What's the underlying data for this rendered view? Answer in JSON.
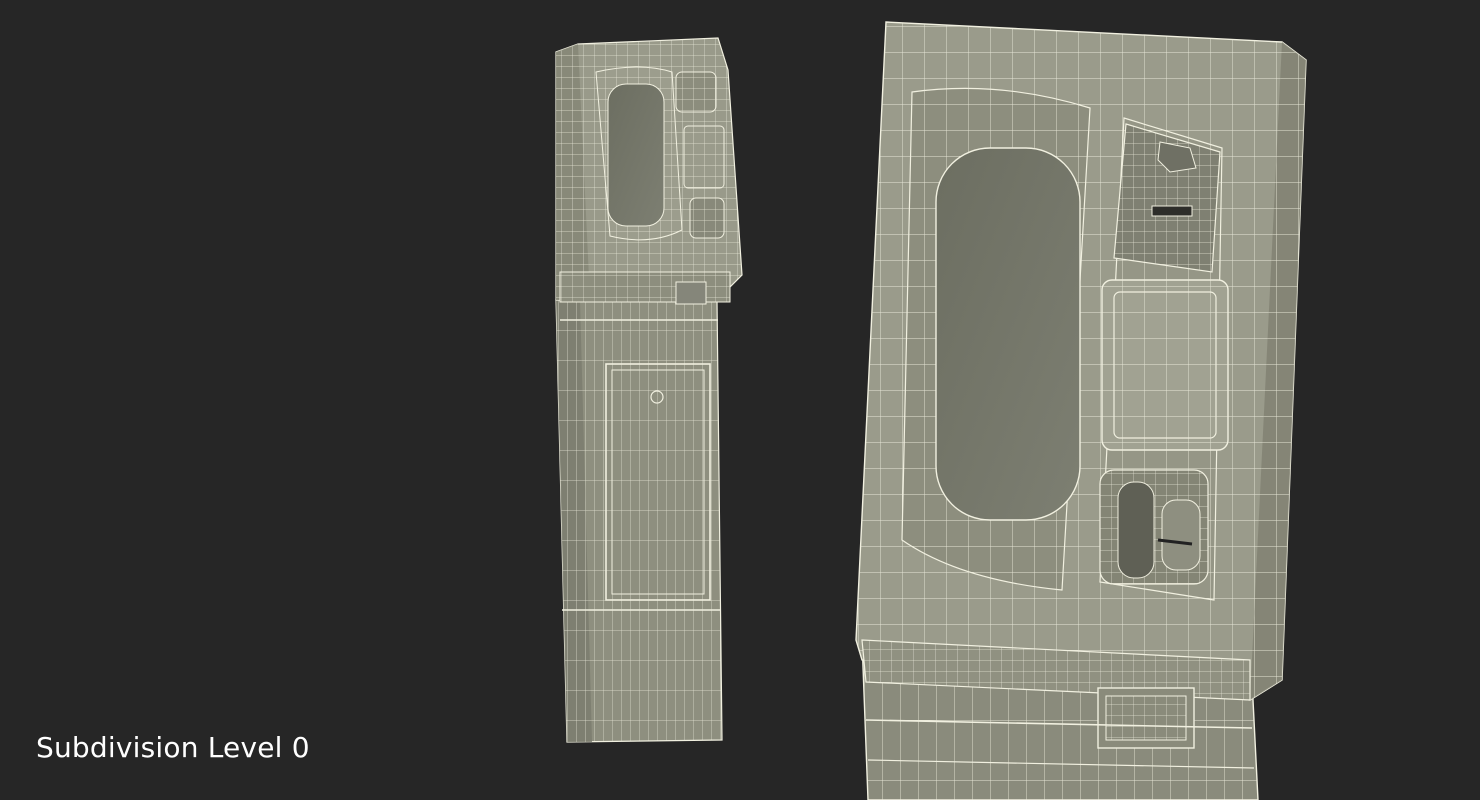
{
  "caption": {
    "text": "Subdivision Level 0"
  },
  "scene": {
    "background": "#262626",
    "model_fill": "#8f9080",
    "model_fill_dark": "#6f7163",
    "model_fill_light": "#a3a494",
    "wire_color": "#f1f0e0",
    "screen_fill": "#74766a"
  }
}
